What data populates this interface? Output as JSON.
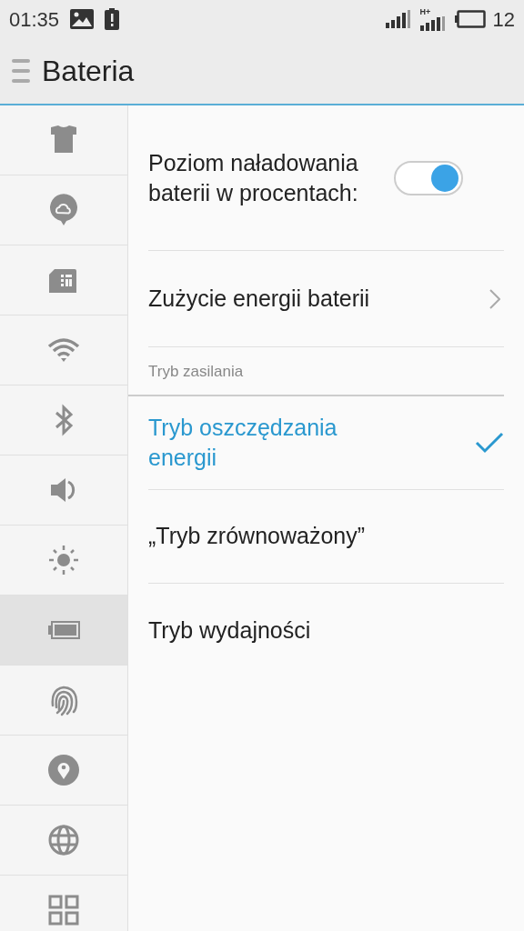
{
  "status_bar": {
    "time": "01:35",
    "network_label": "H+",
    "battery_text": "12"
  },
  "header": {
    "title": "Bateria"
  },
  "sidebar": {
    "items": [
      {
        "kind": "shirt",
        "selected": false
      },
      {
        "kind": "cloud",
        "selected": false
      },
      {
        "kind": "sim",
        "selected": false
      },
      {
        "kind": "wifi",
        "selected": false
      },
      {
        "kind": "bluetooth",
        "selected": false
      },
      {
        "kind": "sound",
        "selected": false
      },
      {
        "kind": "brightness",
        "selected": false
      },
      {
        "kind": "battery",
        "selected": true
      },
      {
        "kind": "fingerprint",
        "selected": false
      },
      {
        "kind": "location",
        "selected": false
      },
      {
        "kind": "globe",
        "selected": false
      },
      {
        "kind": "apps",
        "selected": false
      }
    ]
  },
  "settings": [
    {
      "kind": "toggle",
      "label": "Poziom naładowania baterii w procentach:",
      "on": true
    },
    {
      "kind": "link",
      "label": "Zużycie energii baterii"
    }
  ],
  "power_mode": {
    "section_title": "Tryb zasilania",
    "options": [
      {
        "label": "Tryb oszczędzania energii",
        "selected": true
      },
      {
        "label": "„Tryb zrównoważony”",
        "selected": false
      },
      {
        "label": "Tryb wydajności",
        "selected": false
      }
    ]
  }
}
